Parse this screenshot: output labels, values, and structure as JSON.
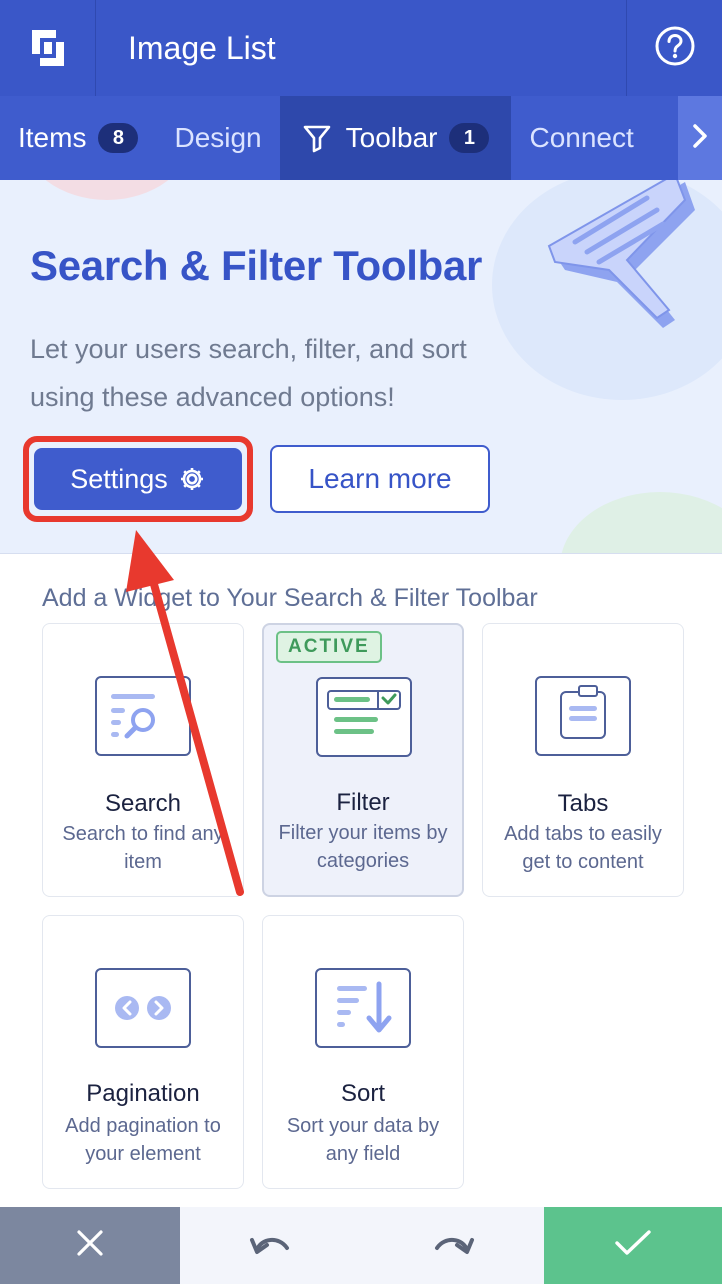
{
  "header": {
    "title": "Image List"
  },
  "tabs": [
    {
      "label": "Items",
      "count": "8"
    },
    {
      "label": "Design"
    },
    {
      "label": "Toolbar",
      "count": "1"
    },
    {
      "label": "Connect"
    }
  ],
  "hero": {
    "title": "Search & Filter Toolbar",
    "description": "Let your users search, filter, and sort using these advanced options!",
    "settings_label": "Settings",
    "learn_more_label": "Learn more"
  },
  "widgets": {
    "section_title": "Add a Widget to Your Search & Filter Toolbar",
    "active_badge": "ACTIVE",
    "items": [
      {
        "name": "Search",
        "description": "Search to find any item"
      },
      {
        "name": "Filter",
        "description": "Filter your items by categories"
      },
      {
        "name": "Tabs",
        "description": "Add tabs to easily get to content"
      },
      {
        "name": "Pagination",
        "description": "Add pagination to your element"
      },
      {
        "name": "Sort",
        "description": "Sort your data by any field"
      }
    ]
  },
  "colors": {
    "primary": "#3f5ccd",
    "header": "#3a57c8",
    "highlight": "#e8392e",
    "save": "#5cc38d",
    "cancel": "#7c879f",
    "active_badge": "#3f9a5b"
  },
  "icons": {
    "logo": "brand-logo-icon",
    "help": "question-circle-icon",
    "toolbar_tab": "funnel-icon",
    "next": "chevron-right-icon",
    "settings": "gear-icon",
    "cancel": "close-icon",
    "undo": "undo-icon",
    "redo": "redo-icon",
    "save": "check-icon"
  }
}
